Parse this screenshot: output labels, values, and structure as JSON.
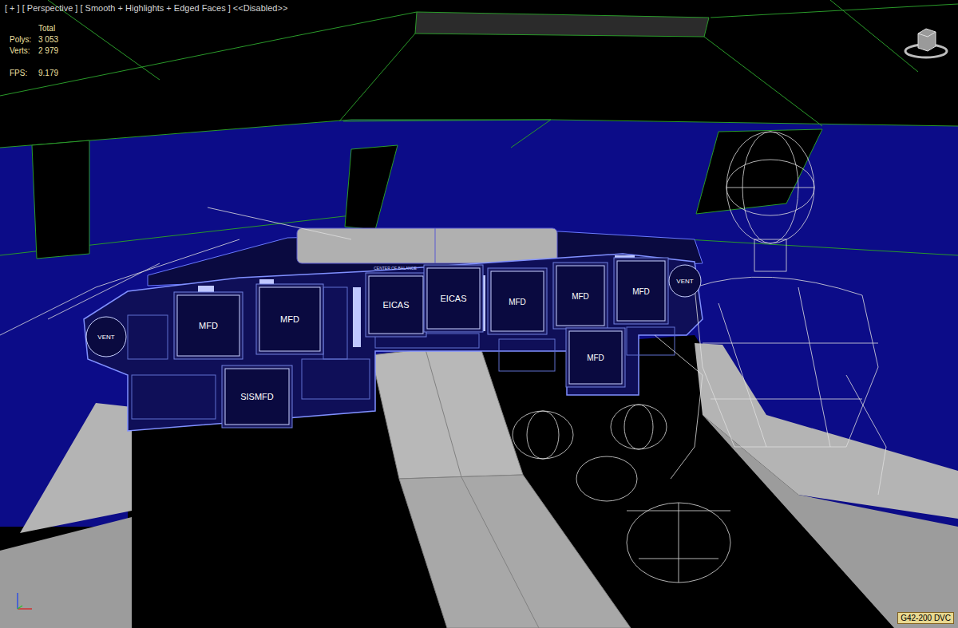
{
  "viewport": {
    "label": "[ + ] [ Perspective ] [ Smooth + Highlights + Edged Faces ] <<Disabled>>"
  },
  "stats": {
    "header": "Total",
    "rows": [
      {
        "label": "Polys:",
        "value": "3 053"
      },
      {
        "label": "Verts:",
        "value": "2 979"
      },
      {
        "label": "FPS:",
        "value": "9.179"
      }
    ]
  },
  "panel": {
    "displays": [
      {
        "label": "MFD"
      },
      {
        "label": "MFD"
      },
      {
        "label": "SISMFD"
      },
      {
        "label": "EICAS"
      },
      {
        "label": "EICAS"
      },
      {
        "label": "MFD"
      },
      {
        "label": "MFD"
      },
      {
        "label": "MFD"
      },
      {
        "label": "MFD"
      }
    ],
    "vents": [
      {
        "label": "VENT"
      },
      {
        "label": "VENT"
      }
    ],
    "captions": [
      "CENTER OF BALANCE"
    ]
  },
  "badge": "G42-200 DVC"
}
